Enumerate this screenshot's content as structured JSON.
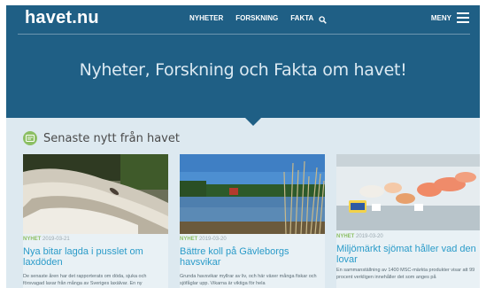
{
  "header": {
    "logo": "havet.nu",
    "nav": [
      "NYHETER",
      "FORSKNING",
      "FAKTA"
    ],
    "menu_label": "MENY"
  },
  "hero": {
    "tagline": "Nyheter, Forskning och Fakta om havet!"
  },
  "section": {
    "title": "Senaste nytt från havet"
  },
  "cards": [
    {
      "category": "NYHET",
      "date": "2019-03-21",
      "title": "Nya bitar lagda i pusslet om laxdöden",
      "excerpt": "De senaste åren har det rapporterats om döda, sjuka och försvagad laxar från många av Sveriges laxälvar. En ny"
    },
    {
      "category": "NYHET",
      "date": "2019-03-20",
      "title": "Bättre koll på Gävleborgs havsvikar",
      "excerpt": "Grunda havsvikar myllrar av liv, och här växer många fiskar och sjöfåglar upp. Vikarna är viktiga för hela"
    },
    {
      "category": "NYHET",
      "date": "2019-03-20",
      "title": "Miljömärkt sjömat håller vad den lovar",
      "excerpt": "En sammanställning av 1400 MSC-märkta produkter visar att 99 procent verkligen innehåller det som anges på"
    }
  ],
  "colors": {
    "hero_bg": "#1f5f85",
    "link": "#2a9bc9",
    "category": "#8cbf64"
  },
  "icons": [
    "search-icon",
    "menu-icon",
    "news-icon"
  ]
}
